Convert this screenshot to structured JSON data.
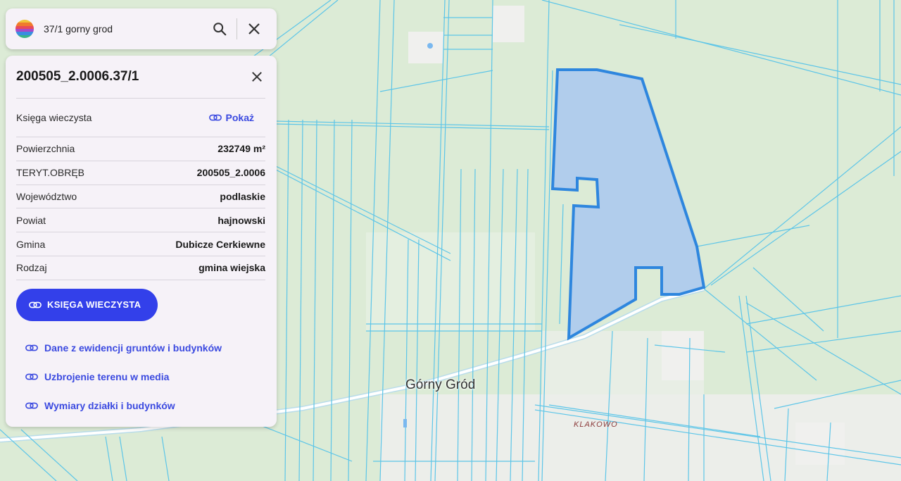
{
  "search": {
    "query": "37/1  gorny grod"
  },
  "parcel": {
    "id": "200505_2.0006.37/1",
    "land_register_label": "Księga wieczysta",
    "show_label": "Pokaż",
    "properties": [
      {
        "label": "Powierzchnia",
        "value": "232749 m²"
      },
      {
        "label": "TERYT.OBRĘB",
        "value": "200505_2.0006"
      },
      {
        "label": "Województwo",
        "value": "podlaskie"
      },
      {
        "label": "Powiat",
        "value": "hajnowski"
      },
      {
        "label": "Gmina",
        "value": "Dubicze Cerkiewne"
      },
      {
        "label": "Rodzaj",
        "value": "gmina wiejska"
      }
    ],
    "primary_button": "KSIĘGA WIECZYSTA",
    "links": [
      "Dane z ewidencji gruntów i budynków",
      "Uzbrojenie terenu w media",
      "Wymiary działki i budynków"
    ]
  },
  "map": {
    "town_label": "Górny Gród",
    "locality_label": "KLAKOWO"
  },
  "colors": {
    "accent": "#3340ea",
    "link": "#3b4ae0",
    "parcel_fill": "#a9c8f0",
    "parcel_stroke": "#2e86de",
    "boundary": "#5cc5e8"
  },
  "icons": [
    "app-logo-icon",
    "search-icon",
    "close-icon",
    "link-icon"
  ]
}
